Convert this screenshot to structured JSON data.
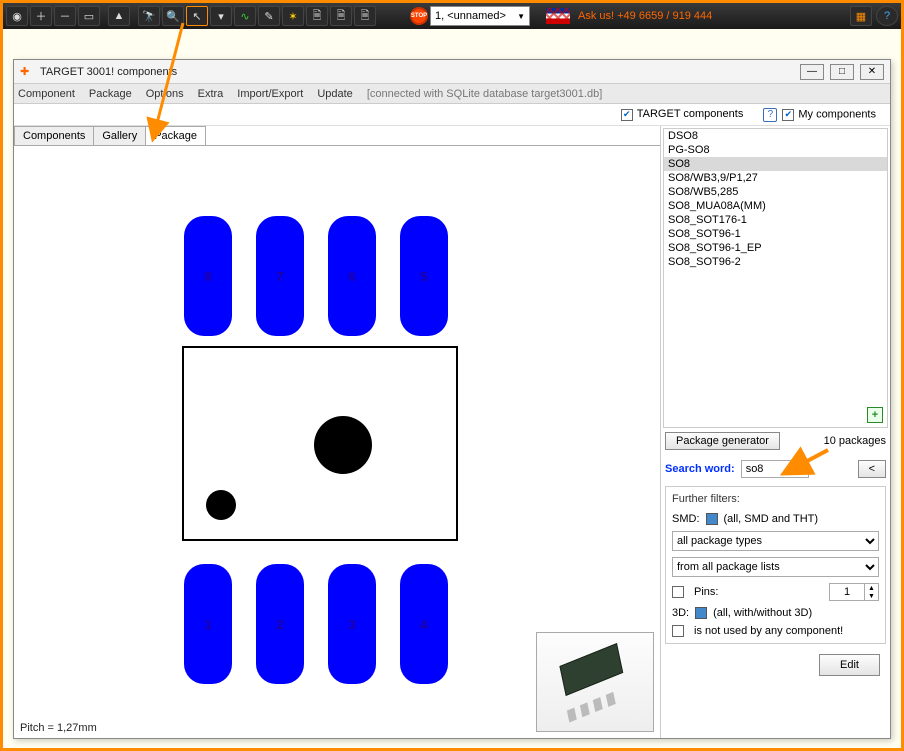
{
  "toolbar": {
    "combo_value": "1, <unnamed>",
    "askus": "Ask us! +49 6659 / 919 444"
  },
  "dialog": {
    "title": "TARGET 3001! components"
  },
  "menu": {
    "component": "Component",
    "package": "Package",
    "options": "Options",
    "extra": "Extra",
    "import_export": "Import/Export",
    "update": "Update",
    "connection": "[connected with SQLite database target3001.db]"
  },
  "opts": {
    "target_components": "TARGET components",
    "my_components": "My components"
  },
  "tabs": {
    "components": "Components",
    "gallery": "Gallery",
    "package": "Package"
  },
  "footprint": {
    "pitch": "Pitch = 1,27mm",
    "pads_top": [
      "8",
      "7",
      "6",
      "5"
    ],
    "pads_bottom": [
      "1",
      "2",
      "3",
      "4"
    ]
  },
  "packages": {
    "list": [
      "DSO8",
      "PG-SO8",
      "SO8",
      "SO8/WB3,9/P1,27",
      "SO8/WB5,285",
      "SO8_MUA08A(MM)",
      "SO8_SOT176-1",
      "SO8_SOT96-1",
      "SO8_SOT96-1_EP",
      "SO8_SOT96-2"
    ],
    "selected_index": 2,
    "generator_btn": "Package generator",
    "count_label": "10 packages"
  },
  "search": {
    "label": "Search word:",
    "value": "so8",
    "back": "<"
  },
  "filters": {
    "header": "Further filters:",
    "smd_label": "SMD:",
    "smd_value": "(all, SMD and THT)",
    "types_select": "all package types",
    "lists_select": "from all package lists",
    "pins_label": "Pins:",
    "pins_value": "1",
    "three_d_label": "3D:",
    "three_d_value": "(all, with/without 3D)",
    "notused_label": "is not used by any component!"
  },
  "edit_btn": "Edit"
}
